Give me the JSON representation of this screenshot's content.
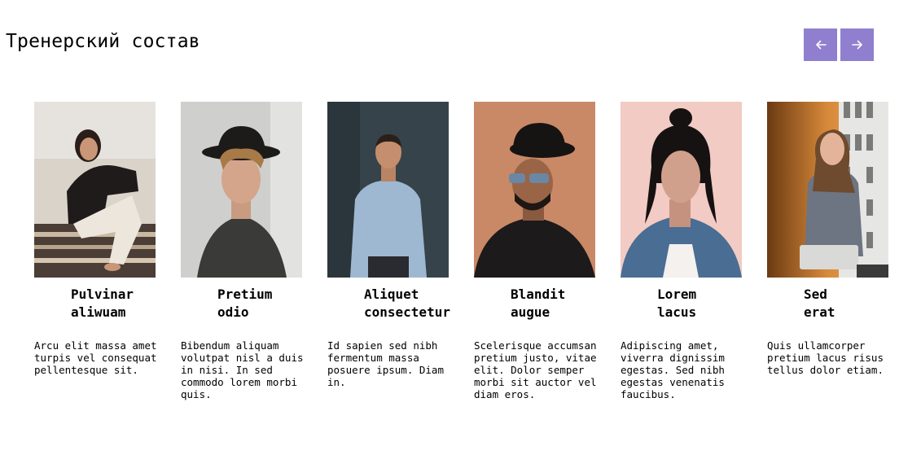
{
  "page": {
    "title": "Тренерский состав"
  },
  "nav": {
    "prev_icon": "arrow-left-icon",
    "next_icon": "arrow-right-icon",
    "accent_color": "#8f7fce"
  },
  "trainers": [
    {
      "name": "Pulvinar\naliwuam",
      "description": "Arcu elit massa amet\nturpis vel consequat\npellentesque sit."
    },
    {
      "name": "Pretium\nodio",
      "description": "Bibendum aliquam\nvolutpat nisl a duis\nin nisi. In sed\ncommodo lorem morbi\nquis."
    },
    {
      "name": "Aliquet\nconsectetur",
      "description": "Id sapien sed nibh\nfermentum massa\nposuere ipsum. Diam\nin."
    },
    {
      "name": "Blandit\naugue",
      "description": "Scelerisque accumsan\npretium justo, vitae\nelit. Dolor semper\nmorbi sit auctor vel\ndiam eros."
    },
    {
      "name": "Lorem\nlacus",
      "description": "Adipiscing amet,\nviverra dignissim\negestas. Sed nibh\negestas venenatis\nfaucibus."
    },
    {
      "name": "Sed\nerat",
      "description": "Quis ullamcorper\npretium lacus risus\ntellus dolor etiam."
    }
  ]
}
